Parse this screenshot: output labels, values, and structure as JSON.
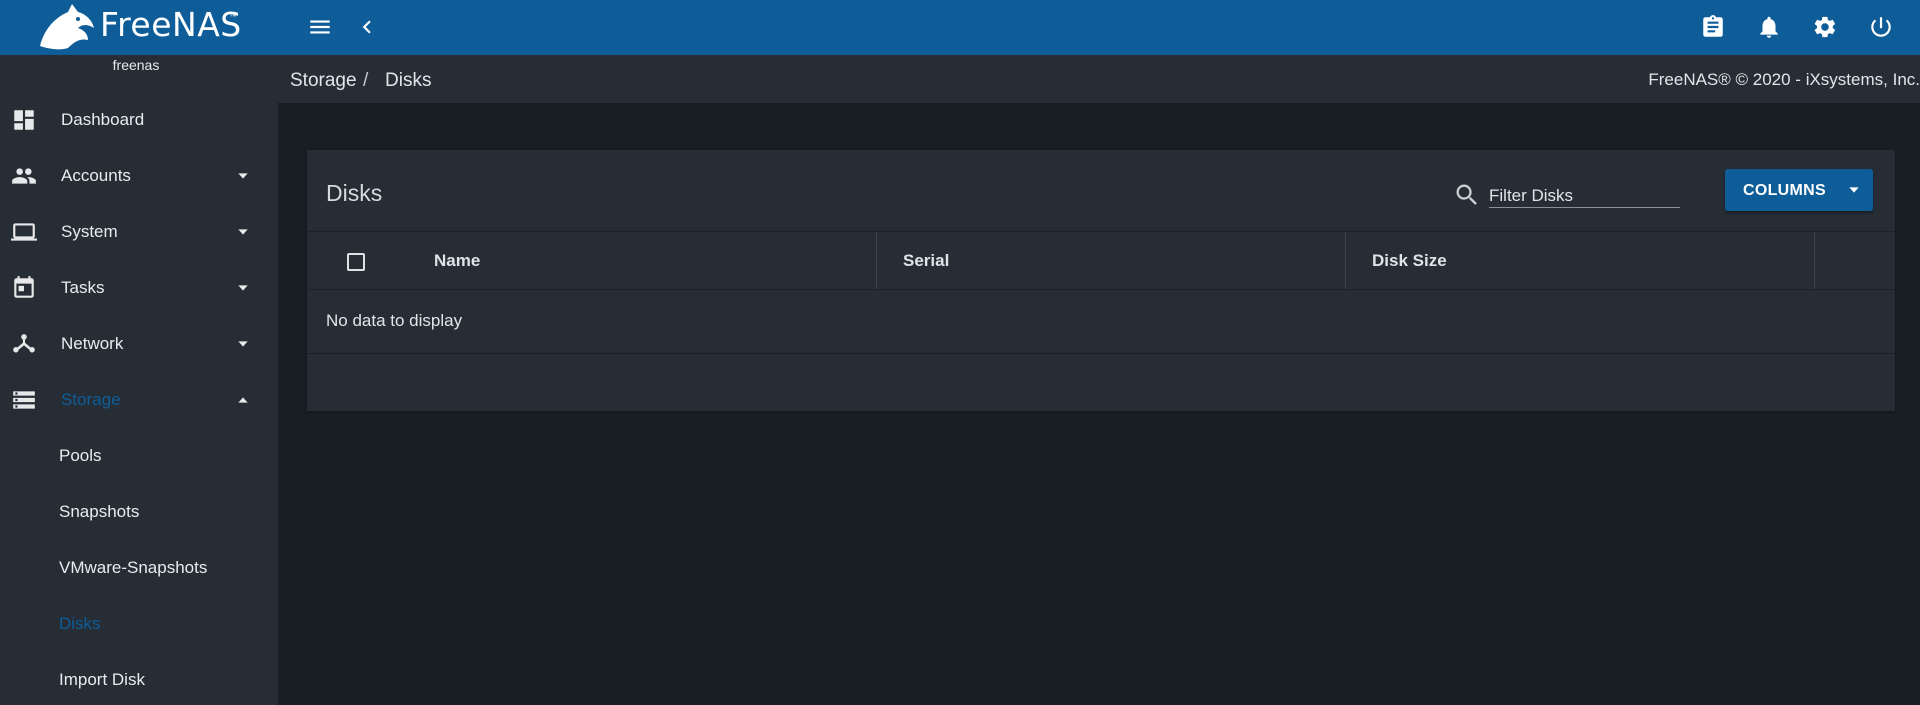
{
  "app": {
    "brand": "FreeNAS",
    "trademark": "™",
    "hostname": "freenas"
  },
  "topbar": {
    "icons": [
      "menu-icon",
      "chevron-left-icon",
      "clipboard-icon",
      "bell-icon",
      "gear-icon",
      "power-icon"
    ]
  },
  "sidebar": {
    "items": [
      {
        "label": "Dashboard",
        "icon": "dashboard-icon",
        "expandable": false
      },
      {
        "label": "Accounts",
        "icon": "people-icon",
        "expandable": true,
        "expanded": false
      },
      {
        "label": "System",
        "icon": "laptop-icon",
        "expandable": true,
        "expanded": false
      },
      {
        "label": "Tasks",
        "icon": "calendar-icon",
        "expandable": true,
        "expanded": false
      },
      {
        "label": "Network",
        "icon": "network-icon",
        "expandable": true,
        "expanded": false
      },
      {
        "label": "Storage",
        "icon": "storage-icon",
        "expandable": true,
        "expanded": true,
        "active": true
      }
    ],
    "storage_children": [
      {
        "label": "Pools"
      },
      {
        "label": "Snapshots"
      },
      {
        "label": "VMware-Snapshots"
      },
      {
        "label": "Disks",
        "active": true
      },
      {
        "label": "Import Disk"
      }
    ],
    "active_color": "#0e5d99"
  },
  "breadcrumb": {
    "parent": "Storage",
    "separator": "/",
    "current": "Disks"
  },
  "copyright": "FreeNAS® © 2020 - iXsystems, Inc.",
  "card": {
    "title": "Disks",
    "filter_placeholder": "Filter Disks",
    "filter_value": "",
    "columns_button": "COLUMNS",
    "table": {
      "headers": [
        "Name",
        "Serial",
        "Disk Size"
      ],
      "rows": [],
      "empty_message": "No data to display"
    }
  },
  "colors": {
    "topbar": "#0e5d99",
    "sidebar": "#262d35",
    "background": "#191e25",
    "accent": "#0e5d99"
  }
}
